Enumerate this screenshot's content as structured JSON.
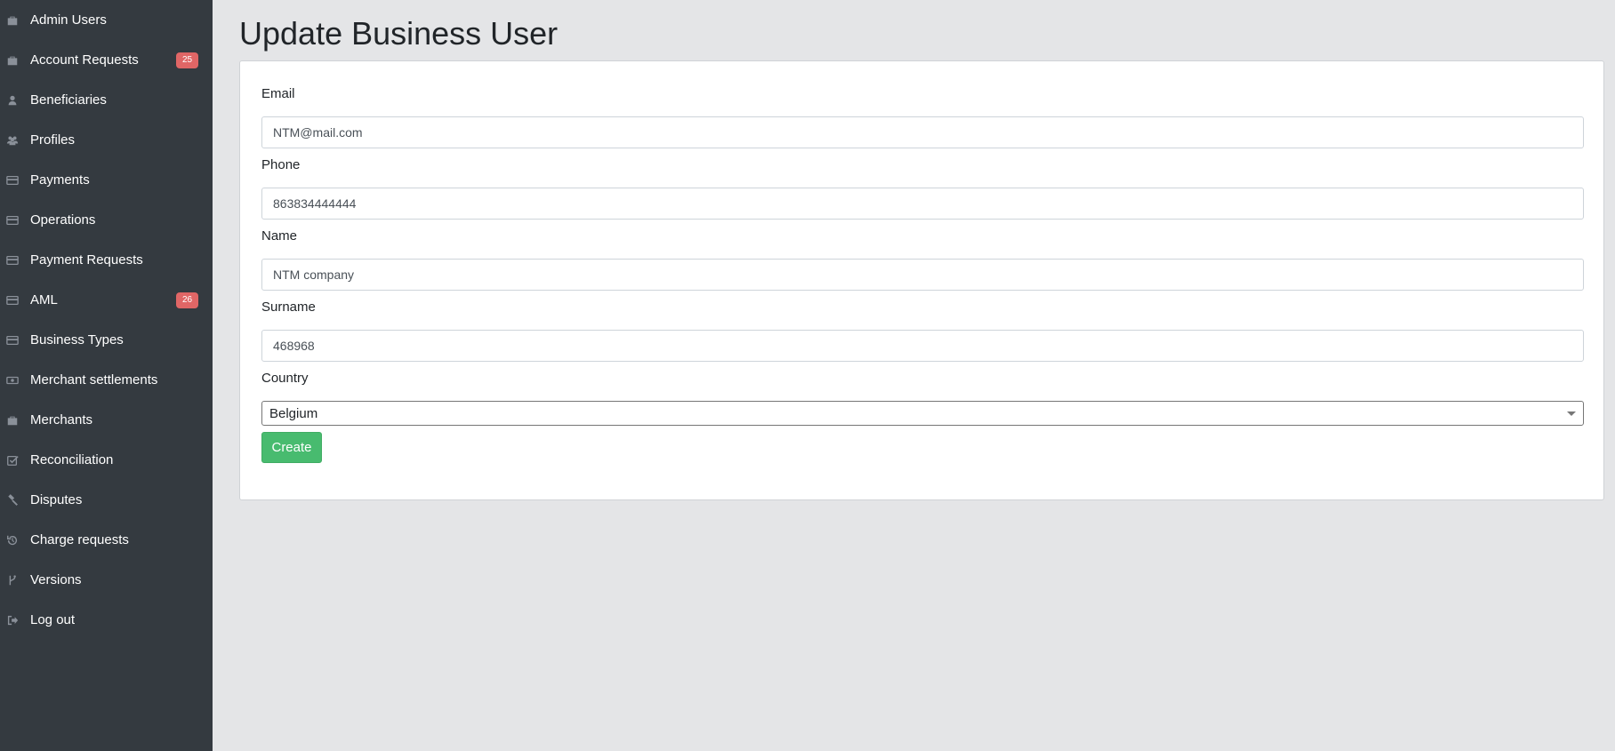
{
  "sidebar": {
    "items": [
      {
        "label": "Admin Users",
        "icon": "briefcase-icon"
      },
      {
        "label": "Account Requests",
        "icon": "briefcase-icon",
        "badge": "25"
      },
      {
        "label": "Beneficiaries",
        "icon": "user-icon"
      },
      {
        "label": "Profiles",
        "icon": "users-icon"
      },
      {
        "label": "Payments",
        "icon": "credit-card-icon"
      },
      {
        "label": "Operations",
        "icon": "credit-card-icon"
      },
      {
        "label": "Payment Requests",
        "icon": "credit-card-icon"
      },
      {
        "label": "AML",
        "icon": "credit-card-icon",
        "badge": "26"
      },
      {
        "label": "Business Types",
        "icon": "credit-card-icon"
      },
      {
        "label": "Merchant settlements",
        "icon": "money-bill-icon"
      },
      {
        "label": "Merchants",
        "icon": "briefcase-icon"
      },
      {
        "label": "Reconciliation",
        "icon": "check-square-icon"
      },
      {
        "label": "Disputes",
        "icon": "gavel-icon"
      },
      {
        "label": "Charge requests",
        "icon": "history-icon"
      },
      {
        "label": "Versions",
        "icon": "code-branch-icon"
      },
      {
        "label": "Log out",
        "icon": "sign-out-icon"
      }
    ],
    "colors": {
      "background": "#343a40",
      "badge": "#e06666",
      "icon": "#8a9099"
    }
  },
  "main": {
    "title": "Update Business User",
    "form": {
      "email": {
        "label": "Email",
        "value": "NTM@mail.com"
      },
      "phone": {
        "label": "Phone",
        "value": "863834444444"
      },
      "name": {
        "label": "Name",
        "value": "NTM company"
      },
      "surname": {
        "label": "Surname",
        "value": "468968"
      },
      "country": {
        "label": "Country",
        "value": "Belgium"
      },
      "submit_label": "Create"
    },
    "colors": {
      "background": "#e4e5e7",
      "button": "#48bb6f"
    }
  }
}
